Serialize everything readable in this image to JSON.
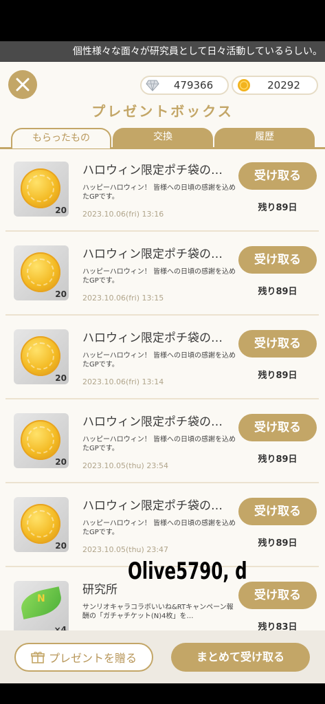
{
  "ticker": {
    "text": "個性様々な面々が研究員として日々活動しているらしい。"
  },
  "currencies": {
    "gems": "479366",
    "coins": "20292"
  },
  "title": "プレゼントボックス",
  "tabs": [
    "もらったもの",
    "交換",
    "履歴"
  ],
  "items": [
    {
      "title": "ハロウィン限定ポチ袋の…",
      "desc": "ハッピーハロウィン！ 皆様への日頃の感謝を込めたGPです。",
      "date": "2023.10.06(fri) 13:16",
      "qty": "20",
      "btn": "受け取る",
      "remaining": "残り89日",
      "icon": "gold-coin-icon"
    },
    {
      "title": "ハロウィン限定ポチ袋の…",
      "desc": "ハッピーハロウィン！ 皆様への日頃の感謝を込めたGPです。",
      "date": "2023.10.06(fri) 13:15",
      "qty": "20",
      "btn": "受け取る",
      "remaining": "残り89日",
      "icon": "gold-coin-icon"
    },
    {
      "title": "ハロウィン限定ポチ袋の…",
      "desc": "ハッピーハロウィン！ 皆様への日頃の感謝を込めたGPです。",
      "date": "2023.10.06(fri) 13:14",
      "qty": "20",
      "btn": "受け取る",
      "remaining": "残り89日",
      "icon": "gold-coin-icon"
    },
    {
      "title": "ハロウィン限定ポチ袋の…",
      "desc": "ハッピーハロウィン！ 皆様への日頃の感謝を込めたGPです。",
      "date": "2023.10.05(thu) 23:54",
      "qty": "20",
      "btn": "受け取る",
      "remaining": "残り89日",
      "icon": "gold-coin-icon"
    },
    {
      "title": "ハロウィン限定ポチ袋の…",
      "desc": "ハッピーハロウィン！ 皆様への日頃の感謝を込めたGPです。",
      "date": "2023.10.05(thu) 23:47",
      "qty": "20",
      "btn": "受け取る",
      "remaining": "残り89日",
      "icon": "gold-coin-icon"
    },
    {
      "title": "研究所",
      "desc": "サンリオキャラコラボいいね&RTキャンペーン報酬の「ガチャチケット(N)4枚」を…",
      "date": "",
      "qty": "×4",
      "btn": "受け取る",
      "remaining": "残り83日",
      "icon": "leaf-ticket-icon",
      "ticket_letter": "N"
    }
  ],
  "watermark": "Olive5790, d",
  "footer": {
    "gift_label": "プレゼントを贈る",
    "receive_all_label": "まとめて受け取る"
  },
  "colors": {
    "accent": "#c3a667",
    "background": "#fbf9f4"
  }
}
